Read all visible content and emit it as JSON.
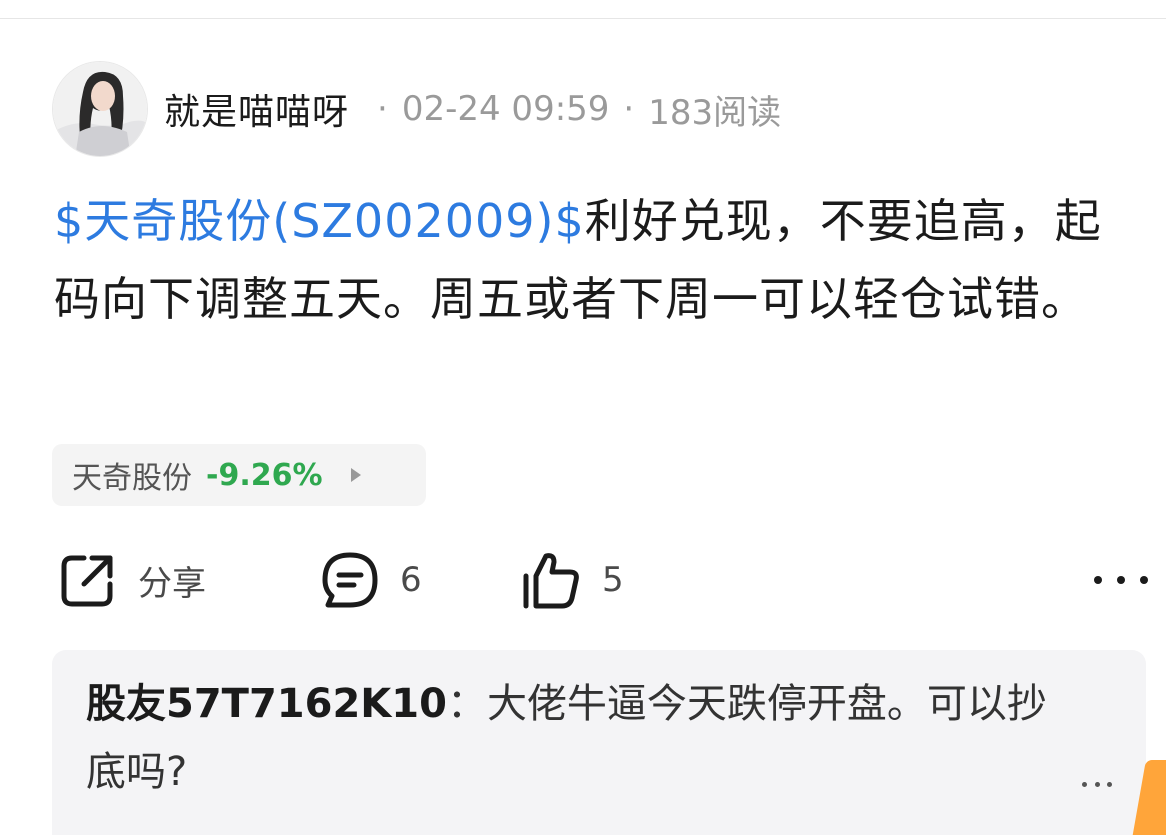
{
  "author": {
    "name": "就是喵喵呀",
    "date": "02-24 09:59",
    "reads": "183阅读"
  },
  "post": {
    "stock_tag": "$天奇股份(SZ002009)$",
    "text": "利好兑现，不要追高，起码向下调整五天。周五或者下周一可以轻仓试错。"
  },
  "stock_chip": {
    "name": "天奇股份",
    "change": "-9.26%",
    "change_color": "#2fa84f"
  },
  "actions": {
    "share_label": "分享",
    "comment_count": "6",
    "like_count": "5"
  },
  "comment_preview": {
    "user": "股友57T7162K10",
    "separator": "：",
    "text": "大佬牛逼今天跌停开盘。可以抄底吗?"
  },
  "colors": {
    "link": "#2d7be0",
    "accent_orange": "#ffa53a"
  },
  "icons": [
    "share-icon",
    "comment-icon",
    "thumbs-up-icon",
    "more-icon"
  ]
}
